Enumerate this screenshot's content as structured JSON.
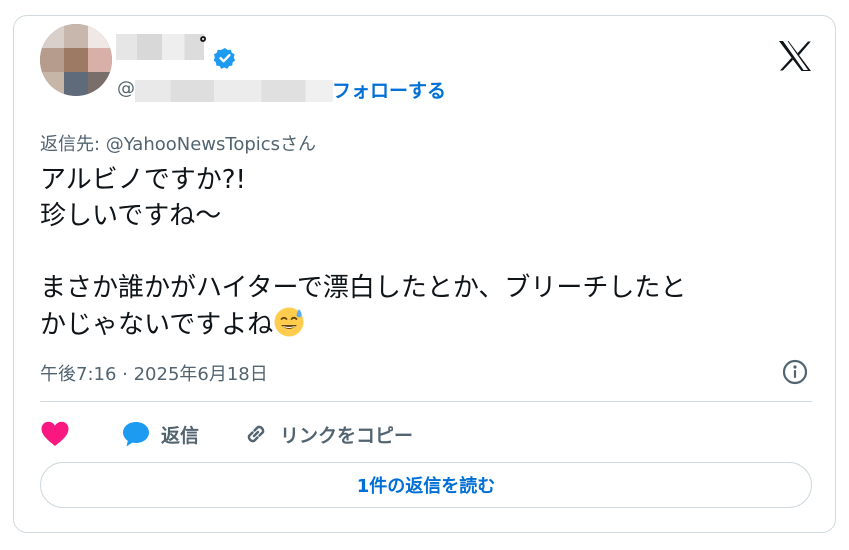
{
  "author": {
    "name_suffix": "゜",
    "handle_prefix": "@",
    "follow_label": "フォローする",
    "verified": true
  },
  "tweet": {
    "reply_to": "返信先: @YahooNewsTopicsさん",
    "lines": [
      "アルビノですか?!",
      "珍しいですね〜",
      "",
      "まさか誰かがハイターで漂白したとか、ブリーチしたと",
      "かじゃないですよね"
    ],
    "emoji": "sweat-smile-emoji",
    "timestamp": "午後7:16 · 2025年6月18日"
  },
  "actions": {
    "like_icon": "heart-icon",
    "reply_label": "返信",
    "copy_link_label": "リンクをコピー"
  },
  "read_replies_label": "1件の返信を読む",
  "colors": {
    "link_blue": "#006fd6",
    "like_pink": "#f91880",
    "verified_blue": "#1d9bf0",
    "muted": "#536471",
    "border": "#cfd9de"
  }
}
